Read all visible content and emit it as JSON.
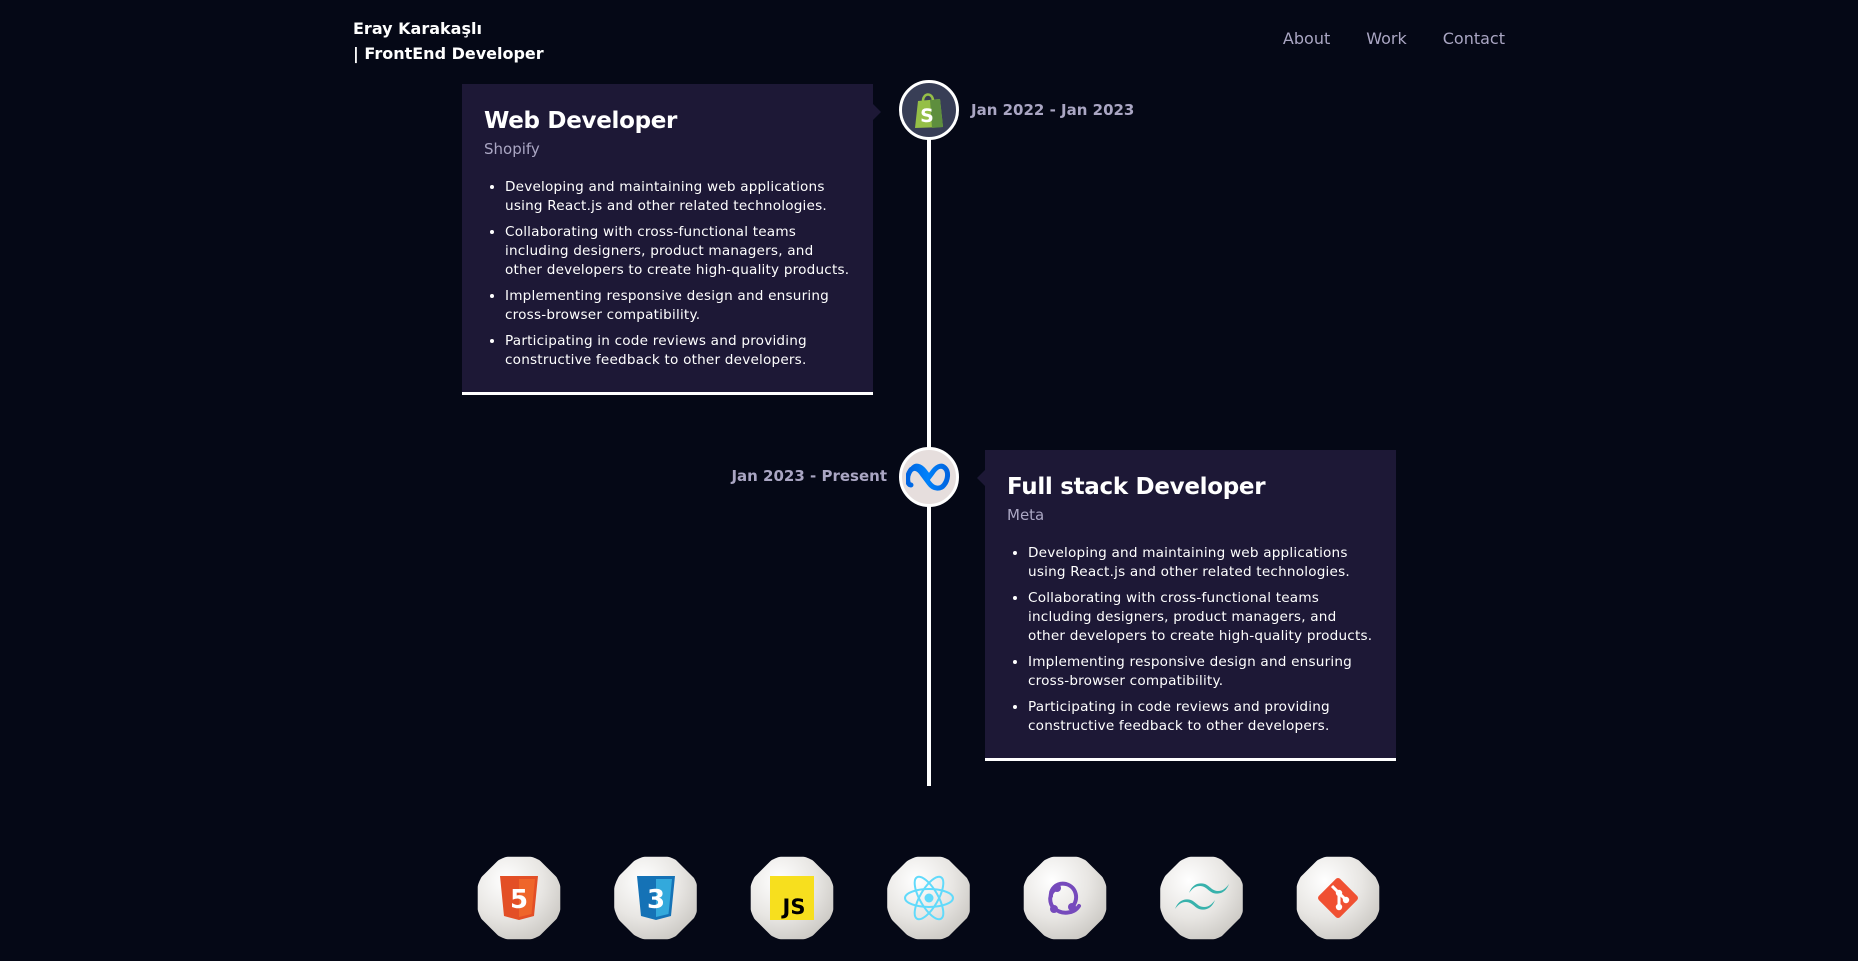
{
  "header": {
    "name": "Eray Karakaşlı",
    "tagline": "| FrontEnd Developer",
    "nav": [
      {
        "label": "About"
      },
      {
        "label": "Work"
      },
      {
        "label": "Contact"
      }
    ]
  },
  "experiences": [
    {
      "title": "Web Developer",
      "company": "Shopify",
      "date": "Jan 2022 - Jan 2023",
      "icon": "shopify-icon",
      "icon_bg": "#383e56",
      "points": [
        "Developing and maintaining web applications using React.js and other related technologies.",
        "Collaborating with cross-functional teams including designers, product managers, and other developers to create high-quality products.",
        "Implementing responsive design and ensuring cross-browser compatibility.",
        "Participating in code reviews and providing constructive feedback to other developers."
      ]
    },
    {
      "title": "Full stack Developer",
      "company": "Meta",
      "date": "Jan 2023 - Present",
      "icon": "meta-icon",
      "icon_bg": "#e6dedd",
      "points": [
        "Developing and maintaining web applications using React.js and other related technologies.",
        "Collaborating with cross-functional teams including designers, product managers, and other developers to create high-quality products.",
        "Implementing responsive design and ensuring cross-browser compatibility.",
        "Participating in code reviews and providing constructive feedback to other developers."
      ]
    }
  ],
  "technologies": [
    {
      "name": "html5-icon",
      "color": "#e34f26"
    },
    {
      "name": "css3-icon",
      "color": "#1572b6"
    },
    {
      "name": "javascript-icon",
      "color": "#f7df1e"
    },
    {
      "name": "react-icon",
      "color": "#61dafb"
    },
    {
      "name": "redux-icon",
      "color": "#764abc"
    },
    {
      "name": "tailwind-icon",
      "color": "#38b2ac"
    },
    {
      "name": "git-icon",
      "color": "#f05032"
    }
  ],
  "colors": {
    "background": "#050816",
    "card": "#1d1836",
    "secondary_text": "#aaa6c3"
  }
}
